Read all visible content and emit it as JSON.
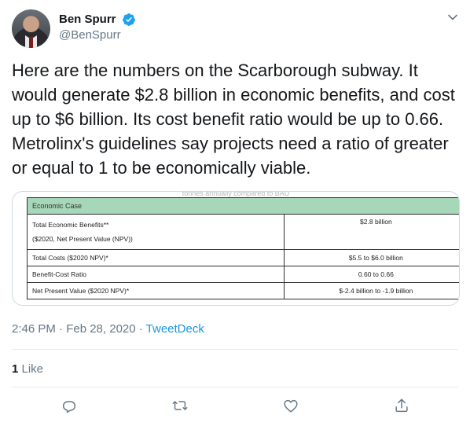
{
  "tweet": {
    "author": {
      "name": "Ben Spurr",
      "handle": "@BenSpurr",
      "verified": true
    },
    "text": "Here are the numbers on the Scarborough subway. It would generate $2.8 billion in economic benefits, and cost up to $6 billion. Its cost benefit ratio would be up to 0.66. Metrolinx's guidelines say projects need a ratio of greater or equal to 1 to be economically viable.",
    "time": "2:46 PM · Feb 28, 2020 · ",
    "source": "TweetDeck",
    "like_count": "1",
    "like_label": " Like"
  },
  "media": {
    "cut_header": "tonnes annually compared to BAU",
    "table": {
      "header": "Economic Case",
      "rows": [
        {
          "label_line1": "Total Economic Benefits**",
          "label_line2": "($2020, Net Present Value (NPV))",
          "value": "$2.8 billion"
        },
        {
          "label_line1": "Total Costs ($2020 NPV)*",
          "value": "$5.5 to $6.0 billion"
        },
        {
          "label_line1": "Benefit-Cost Ratio",
          "value": "0.60 to 0.66"
        },
        {
          "label_line1": "Net Present Value ($2020 NPV)*",
          "value": "$-2.4 billion to -1.9 billion"
        }
      ]
    }
  },
  "colors": {
    "verified": "#1da1f2",
    "link": "#1b95e0",
    "secondary": "#657786",
    "table_header_bg": "#a6d7b8"
  },
  "icons": [
    "verified-badge-icon",
    "chevron-down-icon",
    "reply-icon",
    "retweet-icon",
    "like-icon",
    "share-icon"
  ]
}
